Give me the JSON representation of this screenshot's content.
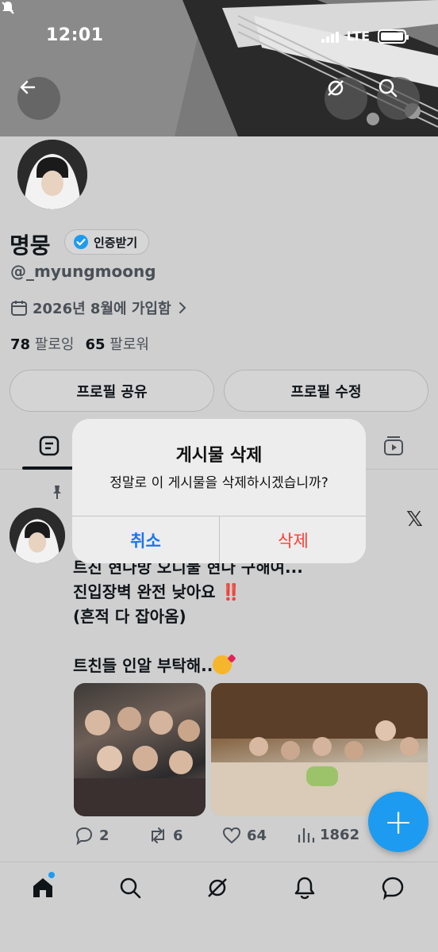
{
  "status_bar": {
    "time": "12:01",
    "network": "LTE"
  },
  "profile": {
    "display_name": "명뭉",
    "verify_label": "인증받기",
    "handle": "@_myungmoong",
    "joined": "2026년 8월에 가입함",
    "following_count": "78",
    "following_label": "팔로잉",
    "followers_count": "65",
    "followers_label": "팔로워",
    "share_button": "프로필 공유",
    "edit_button": "프로필 수정"
  },
  "tweet": {
    "lines": [
      "트친 현나방 오디불 현나 구해여...",
      "진입장벽 완전 낮아요 ‼️",
      "(흔적 다 잡아옴)",
      "",
      "트친들 인알 부탁해.."
    ],
    "replies": "2",
    "retweets": "6",
    "likes": "64",
    "views": "1862"
  },
  "dialog": {
    "title": "게시물 삭제",
    "message": "정말로 이 게시물을 삭제하시겠습니까?",
    "cancel": "취소",
    "delete": "삭제"
  },
  "fab_label": "+",
  "colors": {
    "accent": "#1d9bf0",
    "destructive": "#ff3b30",
    "cancel": "#1877f2"
  },
  "icons": [
    "back-arrow-icon",
    "grok-icon",
    "search-icon",
    "calendar-icon",
    "chevron-right-icon",
    "verified-badge-icon",
    "pin-icon",
    "x-logo-icon",
    "reply-icon",
    "retweet-icon",
    "like-icon",
    "views-icon",
    "home-icon",
    "explore-icon",
    "grok-nav-icon",
    "notifications-icon",
    "messages-icon"
  ]
}
